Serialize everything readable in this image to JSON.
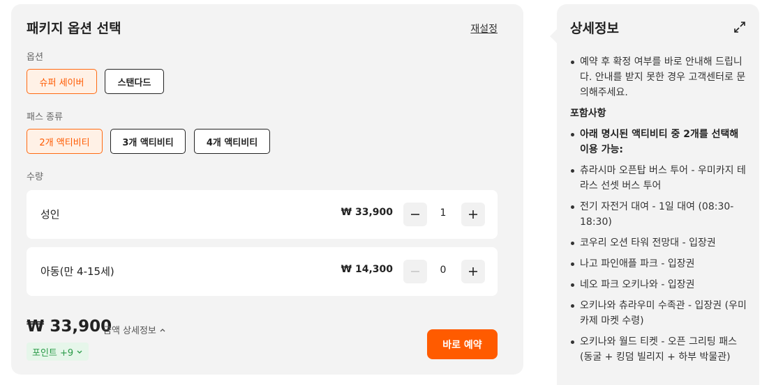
{
  "package": {
    "title": "패키지 옵션 선택",
    "reset_label": "재설정",
    "option_label": "옵션",
    "options": [
      "슈퍼 세이버",
      "스탠다드"
    ],
    "pass_label": "패스 종류",
    "passes": [
      "2개 액티비티",
      "3개 액티비티",
      "4개 액티비티"
    ],
    "quantity_label": "수량",
    "quantities": [
      {
        "name": "성인",
        "price": "₩ 33,900",
        "count": "1"
      },
      {
        "name": "아동(만 4-15세)",
        "price": "₩ 14,300",
        "count": "0"
      }
    ],
    "total": "₩ 33,900",
    "price_detail_label": "금액 상세정보",
    "points_label": "포인트 +9",
    "book_label": "바로 예약"
  },
  "details": {
    "title": "상세정보",
    "notice": "예약 후 확정 여부를 바로 안내해 드립니다. 안내를 받지 못한 경우 고객센터로 문의해주세요.",
    "included_heading": "포함사항",
    "included_intro": "아래 명시된 액티비티 중 2개를 선택해 이용 가능:",
    "included_items": [
      "츄라시마 오픈탑 버스 투어 - 우미카지 테라스 선셋 버스 투어",
      "전기 자전거 대여 - 1일 대여 (08:30-18:30)",
      "코우리 오션 타워 전망대 - 입장권",
      "나고 파인애플 파크 - 입장권",
      "네오 파크 오키나와 - 입장권",
      "오키나와 츄라우미 수족관 - 입장권 (우미카제 마켓 수령)",
      "오키나와 월드 티켓 - 오픈 그리팅 패스 (동굴 + 킹덤 빌리지 + 하부 박물관)"
    ]
  },
  "colors": {
    "accent": "#ff5b00",
    "selected_bg": "#fff1e6",
    "points_green": "#2a9b48",
    "panel_bg": "#f3f3f3"
  },
  "state": {
    "selected_option": "슈퍼 세이버",
    "selected_pass": "2개 액티비티"
  }
}
